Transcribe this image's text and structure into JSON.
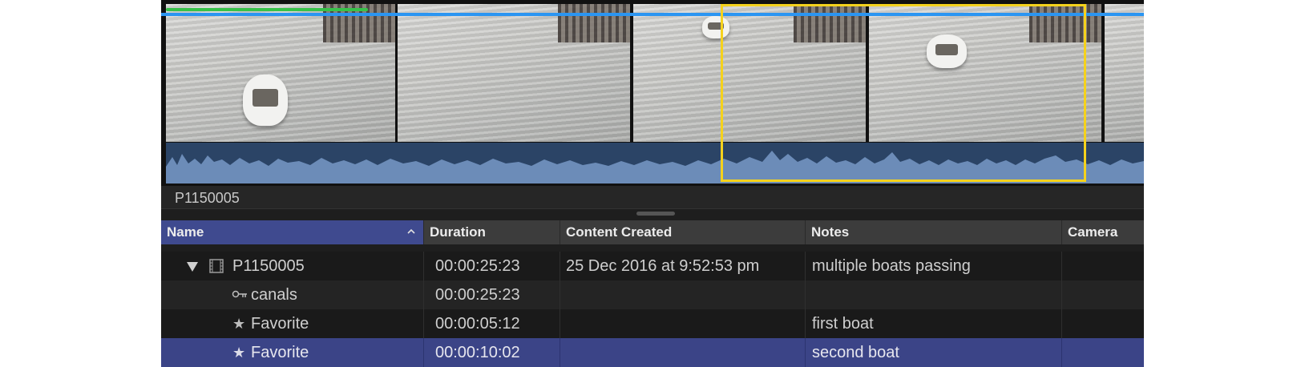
{
  "clip": {
    "label": "P1150005"
  },
  "columns": {
    "name": "Name",
    "duration": "Duration",
    "content_created": "Content Created",
    "notes": "Notes",
    "camera": "Camera"
  },
  "rows": [
    {
      "name": "P1150005",
      "icon": "film-icon",
      "expand": "disclosure-triangle-icon",
      "duration": "00:00:25:23",
      "content_created": "25 Dec 2016 at 9:52:53 pm",
      "notes": "multiple boats passing",
      "camera": ""
    },
    {
      "name": "canals",
      "icon": "keyword-icon",
      "duration": "00:00:25:23",
      "content_created": "",
      "notes": "",
      "camera": ""
    },
    {
      "name": "Favorite",
      "icon": "star-icon",
      "duration": "00:00:05:12",
      "content_created": "",
      "notes": "first boat",
      "camera": ""
    },
    {
      "name": "Favorite",
      "icon": "star-icon",
      "duration": "00:00:10:02",
      "content_created": "",
      "notes": "second boat",
      "camera": "",
      "selected": true
    }
  ],
  "colors": {
    "selection_blue": "#3b4487",
    "range_yellow": "#f5d21c",
    "playhead_blue": "#2a95f2",
    "favorite_green": "#37c24a"
  }
}
